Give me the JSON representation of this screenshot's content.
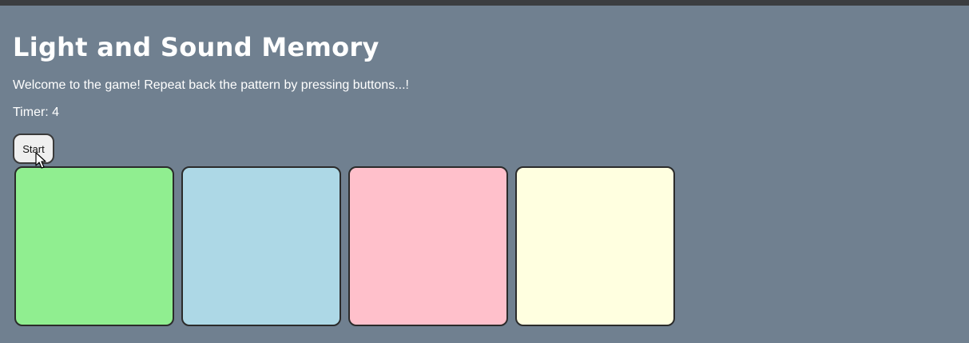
{
  "app": {
    "title": "Light and Sound Memory",
    "welcome": "Welcome to the game! Repeat back the pattern by pressing buttons...!",
    "timer_text": "Timer: 4"
  },
  "controls": {
    "start_label": "Start"
  },
  "pads": [
    {
      "id": 1,
      "color": "#90ee90"
    },
    {
      "id": 2,
      "color": "#add8e6"
    },
    {
      "id": 3,
      "color": "#ffc0cb"
    },
    {
      "id": 4,
      "color": "#ffffe0"
    }
  ],
  "theme": {
    "background": "#708090",
    "text": "#ffffff"
  }
}
